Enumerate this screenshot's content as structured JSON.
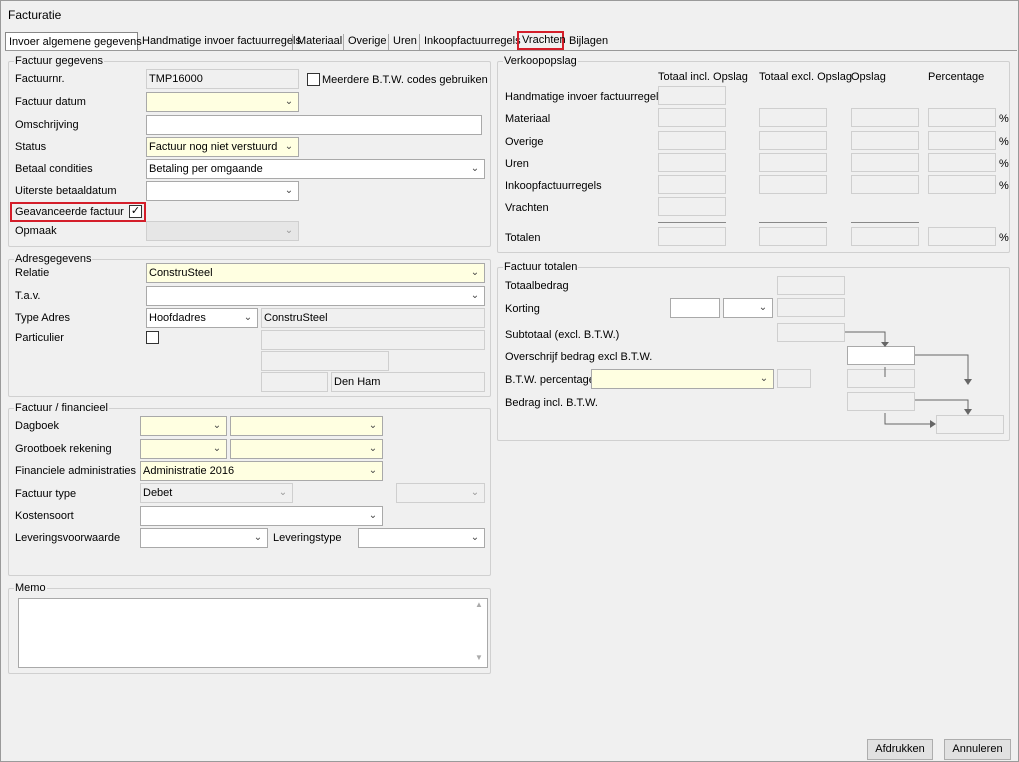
{
  "window": {
    "title": "Facturatie"
  },
  "tabs": [
    {
      "label": "Invoer algemene gegevens",
      "active": true
    },
    {
      "label": "Handmatige invoer factuurregels"
    },
    {
      "label": "Materiaal"
    },
    {
      "label": "Overige"
    },
    {
      "label": "Uren"
    },
    {
      "label": "Inkoopfactuurregels"
    },
    {
      "label": "Vrachten",
      "highlighted": true
    },
    {
      "label": "Bijlagen"
    }
  ],
  "factuur_gegevens": {
    "group_label": "Factuur gegevens",
    "factuurnr_label": "Factuurnr.",
    "factuurnr_value": "TMP16000",
    "meerdere_btw_label": "Meerdere B.T.W. codes gebruiken",
    "meerdere_btw_checked": false,
    "factuur_datum_label": "Factuur datum",
    "factuur_datum_value": "",
    "omschrijving_label": "Omschrijving",
    "omschrijving_value": "",
    "status_label": "Status",
    "status_value": "Factuur nog niet verstuurd",
    "betaal_condities_label": "Betaal condities",
    "betaal_condities_value": "Betaling per omgaande",
    "uiterste_betaaldatum_label": "Uiterste betaaldatum",
    "uiterste_betaaldatum_value": "",
    "geavanceerde_label": "Geavanceerde factuur",
    "geavanceerde_checked": true,
    "opmaak_label": "Opmaak",
    "opmaak_value": ""
  },
  "adresgegevens": {
    "group_label": "Adresgegevens",
    "relatie_label": "Relatie",
    "relatie_value": "ConstruSteel",
    "tav_label": "T.a.v.",
    "tav_value": "",
    "type_adres_label": "Type Adres",
    "type_adres_value": "Hoofdadres",
    "adres_naam": "ConstruSteel",
    "particulier_label": "Particulier",
    "particulier_checked": false,
    "plaats": "Den Ham"
  },
  "financieel": {
    "group_label": "Factuur / financieel",
    "dagboek_label": "Dagboek",
    "grootboek_label": "Grootboek rekening",
    "administraties_label": "Financiele administraties",
    "administraties_value": "Administratie 2016",
    "factuur_type_label": "Factuur type",
    "factuur_type_value": "Debet",
    "kostensoort_label": "Kostensoort",
    "leveringsvoorwaarde_label": "Leveringsvoorwaarde",
    "leveringstype_label": "Leveringstype"
  },
  "memo": {
    "group_label": "Memo",
    "value": ""
  },
  "verkoopopslag": {
    "group_label": "Verkoopopslag",
    "headers": [
      "Totaal incl. Opslag",
      "Totaal excl. Opslag",
      "Opslag",
      "Percentage"
    ],
    "rows": [
      "Handmatige invoer factuurregels",
      "Materiaal",
      "Overige",
      "Uren",
      "Inkoopfactuurregels",
      "Vrachten",
      "Totalen"
    ],
    "percent_sign": "%"
  },
  "factuur_totalen": {
    "group_label": "Factuur totalen",
    "totaalbedrag_label": "Totaalbedrag",
    "korting_label": "Korting",
    "subtotaal_label": "Subtotaal (excl. B.T.W.)",
    "overschrijf_label": "Overschrijf bedrag excl B.T.W.",
    "btw_percentage_label": "B.T.W. percentage",
    "bedrag_incl_label": "Bedrag incl. B.T.W."
  },
  "buttons": {
    "afdrukken": "Afdrukken",
    "annuleren": "Annuleren"
  },
  "colors": {
    "highlight": "#d41e2a",
    "required_field": "#ffffe1",
    "background": "#f0f0f0"
  }
}
